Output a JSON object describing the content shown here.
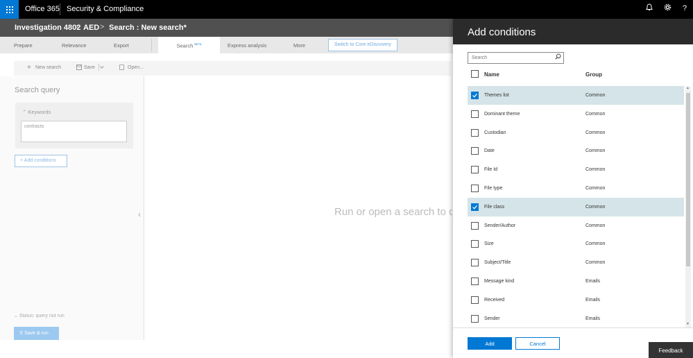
{
  "topbar": {
    "brand": "Office 365",
    "app_name": "Security & Compliance",
    "icons": [
      "bell-icon",
      "gear-icon",
      "help-icon"
    ],
    "help_glyph": "?"
  },
  "breadcrumb": {
    "items": [
      "Investigation 4802",
      "AED",
      "Search : New search*"
    ],
    "separator": ">"
  },
  "tabs": {
    "items": [
      "Prepare",
      "Relevance",
      "Export",
      "Search",
      "Express analysis",
      "More"
    ],
    "beta_label": "BETA",
    "switch_label": "Switch to Core eDiscovery"
  },
  "toolbar": {
    "new_search": "New search",
    "save": "Save",
    "open": "Open..."
  },
  "left_panel": {
    "title": "Search query",
    "keywords_label": "Keywords",
    "keywords_value": "contracts",
    "add_conditions": "Add conditions",
    "status": "Status: query not run",
    "save_run": "Save & run"
  },
  "center": {
    "message": "Run or open a search to d"
  },
  "flyout": {
    "title": "Add conditions",
    "search_placeholder": "Search",
    "col_name": "Name",
    "col_group": "Group",
    "rows": [
      {
        "name": "Themes list",
        "group": "Common",
        "checked": true
      },
      {
        "name": "Dominant theme",
        "group": "Common",
        "checked": false
      },
      {
        "name": "Custodian",
        "group": "Common",
        "checked": false
      },
      {
        "name": "Date",
        "group": "Common",
        "checked": false
      },
      {
        "name": "File Id",
        "group": "Common",
        "checked": false
      },
      {
        "name": "File type",
        "group": "Common",
        "checked": false
      },
      {
        "name": "File class",
        "group": "Common",
        "checked": true
      },
      {
        "name": "Sender/Author",
        "group": "Common",
        "checked": false
      },
      {
        "name": "Size",
        "group": "Common",
        "checked": false
      },
      {
        "name": "Subject/Title",
        "group": "Common",
        "checked": false
      },
      {
        "name": "Message kind",
        "group": "Emails",
        "checked": false
      },
      {
        "name": "Received",
        "group": "Emails",
        "checked": false
      },
      {
        "name": "Sender",
        "group": "Emails",
        "checked": false
      }
    ],
    "add_label": "Add",
    "cancel_label": "Cancel"
  },
  "feedback_label": "Feedback",
  "colors": {
    "accent": "#0078d4",
    "topbar": "#000000",
    "breadcrumb_bar": "#505050",
    "flyout_header": "#2b2b2b",
    "selected_row": "#d5e4e8"
  }
}
